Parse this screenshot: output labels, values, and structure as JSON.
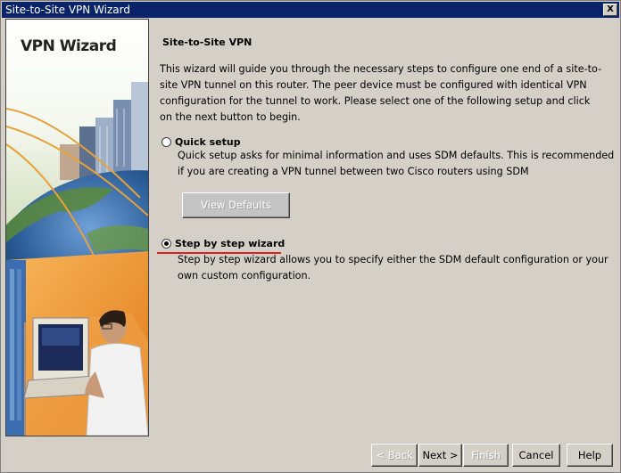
{
  "window": {
    "title": "Site-to-Site VPN Wizard",
    "close_label": "X"
  },
  "art": {
    "title": "VPN Wizard"
  },
  "content": {
    "heading": "Site-to-Site VPN",
    "intro": "This wizard will guide you through the necessary steps to configure one end of a site-to-site VPN tunnel on this router. The peer device must be configured with identical VPN configuration for the tunnel to work. Please select one of the following setup and click on the next button to begin.",
    "options": [
      {
        "label": "Quick setup",
        "selected": false,
        "description": "Quick setup asks for minimal information and uses SDM defaults. This is recommended if you are creating a VPN tunnel between two Cisco routers using SDM",
        "button_label": "View Defaults"
      },
      {
        "label": "Step by step wizard",
        "selected": true,
        "description": "Step by step wizard allows you to specify either the SDM default configuration or your own custom configuration."
      }
    ]
  },
  "footer": {
    "back_label": "< Back",
    "next_label": "Next >",
    "finish_label": "Finish",
    "cancel_label": "Cancel",
    "help_label": "Help"
  },
  "colors": {
    "titlebar": "#0a246a",
    "highlight_underline": "#e02020"
  }
}
